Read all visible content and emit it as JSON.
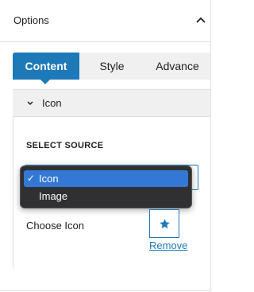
{
  "options": {
    "title": "Options"
  },
  "tabs": [
    {
      "label": "Content",
      "active": true
    },
    {
      "label": "Style",
      "active": false
    },
    {
      "label": "Advance",
      "active": false
    }
  ],
  "icon_section": {
    "title": "Icon",
    "select_source": {
      "label": "SELECT SOURCE",
      "selected": "Icon",
      "options": [
        "Icon",
        "Image"
      ]
    },
    "choose_icon": {
      "label": "Choose Icon",
      "icon": "star-icon",
      "remove_label": "Remove"
    }
  },
  "colors": {
    "accent": "#1d79b8",
    "dropdown_highlight": "#3478d6"
  }
}
